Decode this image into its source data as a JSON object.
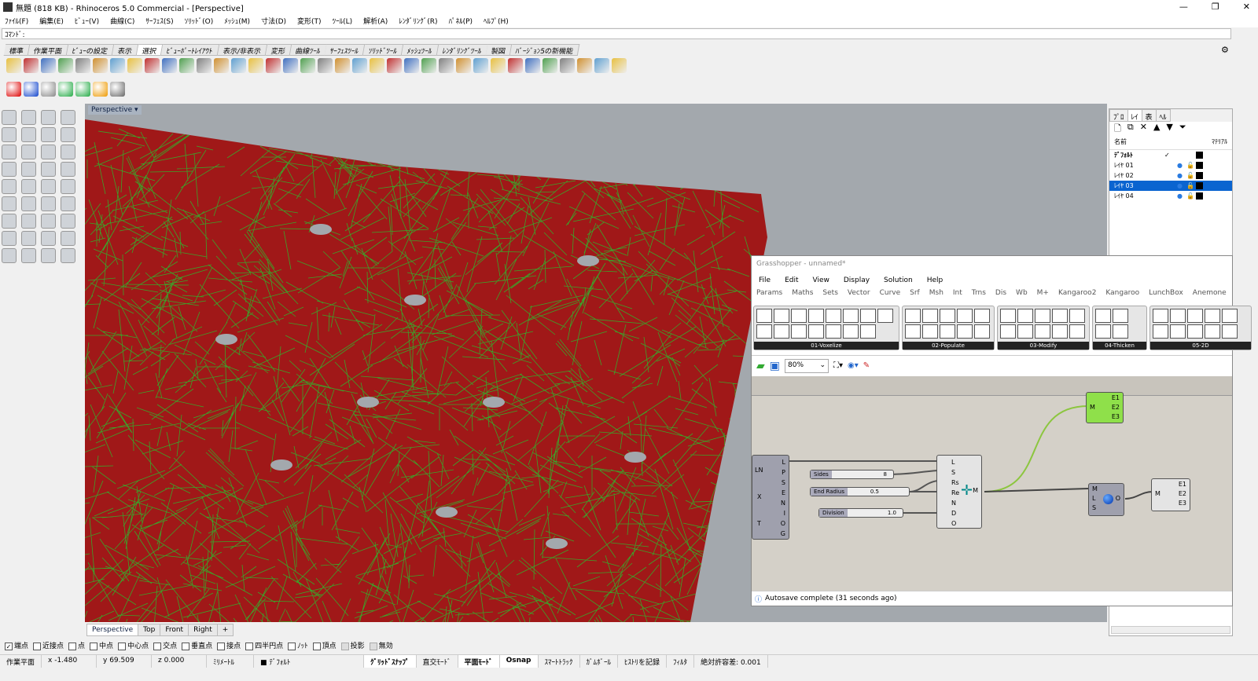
{
  "window": {
    "title": "無題 (818 KB) - Rhinoceros 5.0 Commercial - [Perspective]"
  },
  "menu": [
    "ﾌｧｲﾙ(F)",
    "編集(E)",
    "ﾋﾞｭｰ(V)",
    "曲線(C)",
    "ｻｰﾌｪｽ(S)",
    "ｿﾘｯﾄﾞ(O)",
    "ﾒｯｼｭ(M)",
    "寸法(D)",
    "変形(T)",
    "ﾂｰﾙ(L)",
    "解析(A)",
    "ﾚﾝﾀﾞﾘﾝｸﾞ(R)",
    "ﾊﾟﾈﾙ(P)",
    "ﾍﾙﾌﾟ(H)"
  ],
  "command": {
    "label": "ｺﾏﾝﾄﾞ:",
    "value": ""
  },
  "toolbar_tabs": [
    "標準",
    "作業平面",
    "ﾋﾞｭｰの設定",
    "表示",
    "選択",
    "ﾋﾞｭｰﾎﾟｰﾄﾚｲｱｳﾄ",
    "表示/非表示",
    "変形",
    "曲線ﾂｰﾙ",
    "ｻｰﾌｪｽﾂｰﾙ",
    "ｿﾘｯﾄﾞﾂｰﾙ",
    "ﾒｯｼｭﾂｰﾙ",
    "ﾚﾝﾀﾞﾘﾝｸﾞﾂｰﾙ",
    "製図",
    "ﾊﾞｰｼﾞｮﾝ5の新機能"
  ],
  "active_toolbar_tab": "選択",
  "viewport": {
    "label": "Perspective",
    "tabs": [
      "Perspective",
      "Top",
      "Front",
      "Right",
      "+"
    ],
    "colors": {
      "mesh": "#a01818",
      "wire": "#3aa52a",
      "bg": "#a3a8ad"
    }
  },
  "osnap": [
    {
      "label": "端点",
      "checked": true
    },
    {
      "label": "近接点",
      "checked": false
    },
    {
      "label": "点",
      "checked": false
    },
    {
      "label": "中点",
      "checked": false
    },
    {
      "label": "中心点",
      "checked": false
    },
    {
      "label": "交点",
      "checked": false
    },
    {
      "label": "垂直点",
      "checked": false
    },
    {
      "label": "接点",
      "checked": false
    },
    {
      "label": "四半円点",
      "checked": false
    },
    {
      "label": "ﾉｯﾄ",
      "checked": false
    },
    {
      "label": "頂点",
      "checked": false
    },
    {
      "label": "投影",
      "checked": false,
      "disabled": true
    },
    {
      "label": "無効",
      "checked": false,
      "disabled": true
    }
  ],
  "status": {
    "cplane": "作業平面",
    "x": "x -1.480",
    "y": "y 69.509",
    "z": "z 0.000",
    "units": "ﾐﾘﾒｰﾄﾙ",
    "layer": "ﾃﾞﾌｫﾙﾄ",
    "toggles": [
      {
        "label": "ｸﾞﾘｯﾄﾞｽﾅｯﾌﾟ",
        "on": true
      },
      {
        "label": "直交ﾓｰﾄﾞ",
        "on": false
      },
      {
        "label": "平面ﾓｰﾄﾞ",
        "on": true
      },
      {
        "label": "Osnap",
        "on": true
      },
      {
        "label": "ｽﾏｰﾄﾄﾗｯｸ",
        "on": false
      },
      {
        "label": "ｶﾞﾑﾎﾞｰﾙ",
        "on": false
      },
      {
        "label": "ﾋｽﾄﾘを記録",
        "on": false
      },
      {
        "label": "ﾌｨﾙﾀ",
        "on": false
      }
    ],
    "tolerance": "絶対許容差: 0.001"
  },
  "layers_panel": {
    "tabs": [
      "ﾌﾟﾛ",
      "ﾚｲ",
      "表",
      "ﾍﾙ"
    ],
    "header_name": "名前",
    "header_material": "ﾏﾃﾘｱﾙ",
    "layers": [
      {
        "name": "ﾃﾞﾌｫﾙﾄ",
        "current": true,
        "selected": false
      },
      {
        "name": "ﾚｲﾔ 01",
        "current": false,
        "selected": false
      },
      {
        "name": "ﾚｲﾔ 02",
        "current": false,
        "selected": false
      },
      {
        "name": "ﾚｲﾔ 03",
        "current": false,
        "selected": true
      },
      {
        "name": "ﾚｲﾔ 04",
        "current": false,
        "selected": false
      }
    ]
  },
  "grasshopper": {
    "title": "Grasshopper - unnamed*",
    "menu": [
      "File",
      "Edit",
      "View",
      "Display",
      "Solution",
      "Help"
    ],
    "tabs": [
      "Params",
      "Maths",
      "Sets",
      "Vector",
      "Curve",
      "Srf",
      "Msh",
      "Int",
      "Trns",
      "Dis",
      "Wb",
      "M+",
      "Kangaroo2",
      "Kangaroo",
      "LunchBox",
      "Anemone"
    ],
    "groups": [
      "01-Voxelize",
      "02-Populate",
      "03-Modify",
      "04-Thicken",
      "05-2D"
    ],
    "zoom": "80%",
    "status": "Autosave complete (31 seconds ago)",
    "nodes": {
      "left_inputs": [
        "L",
        "P",
        "S",
        "E",
        "N",
        "I",
        "O",
        "G"
      ],
      "left_labels": [
        "LN",
        "X",
        "T"
      ],
      "exo_inputs": [
        "L",
        "S",
        "Rs",
        "Re",
        "N",
        "D",
        "O"
      ],
      "exo_output": "M",
      "weave_inputs": [
        "M",
        "L",
        "S"
      ],
      "weave_output": "O",
      "edges_input": "M",
      "edges_outputs": [
        "E1",
        "E2",
        "E3"
      ]
    },
    "sliders": [
      {
        "name": "Sides",
        "value": "8"
      },
      {
        "name": "End Radius",
        "value": "0.5"
      },
      {
        "name": "Division",
        "value": "1.0"
      }
    ]
  }
}
